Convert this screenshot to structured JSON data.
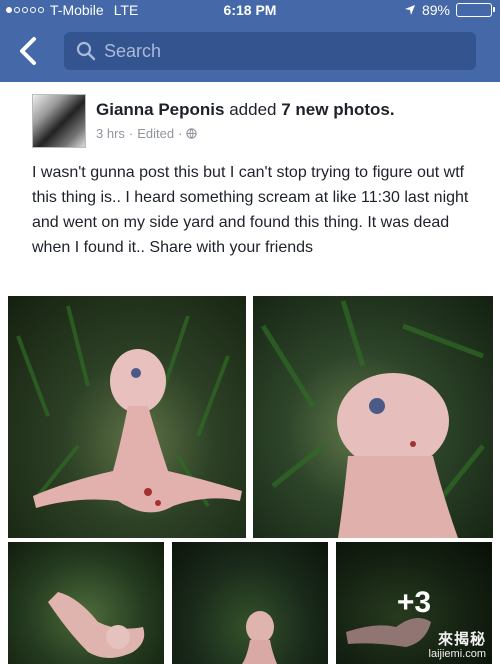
{
  "status_bar": {
    "carrier": "T-Mobile",
    "network": "LTE",
    "time": "6:18 PM",
    "battery": "89%",
    "battery_level": 0.89,
    "signal_icon": "signal-dots-icon",
    "location_icon": "location-arrow-icon"
  },
  "nav": {
    "back_icon": "chevron-left-icon",
    "search_placeholder": "Search",
    "search_icon": "search-icon"
  },
  "post": {
    "author": "Gianna Peponis",
    "action": "added",
    "action_bold": "7 new photos.",
    "time": "3 hrs",
    "edited": "Edited",
    "separator": "·",
    "privacy_icon": "globe-icon",
    "text": "I wasn't gunna post this but I can't stop trying to figure out wtf this thing is.. I heard something scream at like 11:30 last night and went on my side yard and found this thing. It was dead when I found it.. Share with your friends",
    "more_photos": "+3"
  },
  "watermark": {
    "cn": "來揭秘",
    "url": "laijiemi.com"
  },
  "colors": {
    "brand": "#4468a8",
    "search_bg": "#34548f",
    "text": "#1d2129",
    "meta": "#90949c"
  }
}
